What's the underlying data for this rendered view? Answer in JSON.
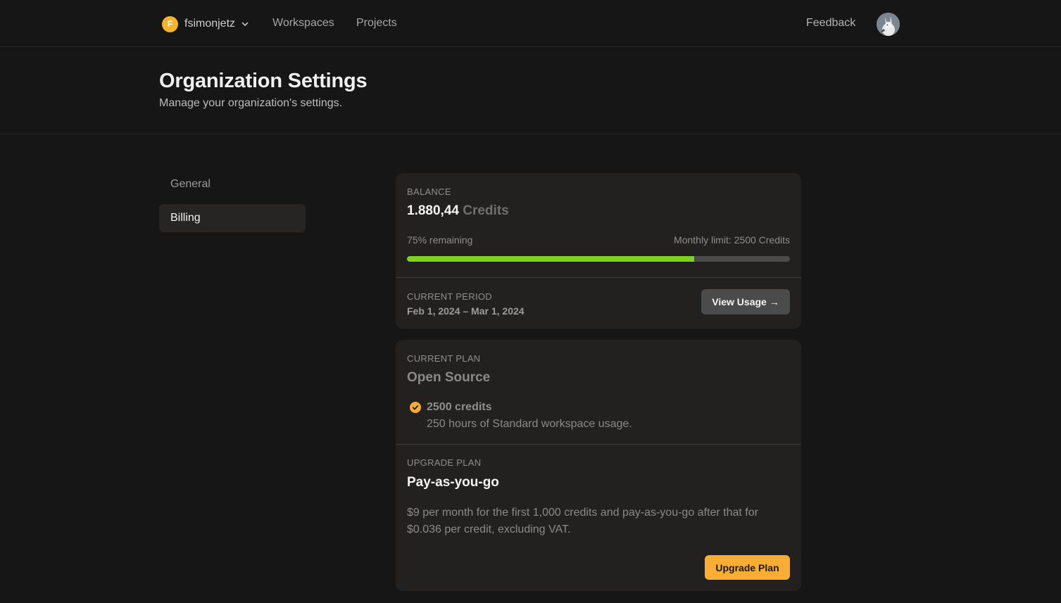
{
  "nav": {
    "org_initial": "F",
    "org_name": "fsimonjetz",
    "links": [
      "Workspaces",
      "Projects"
    ],
    "feedback": "Feedback"
  },
  "header": {
    "title": "Organization Settings",
    "subtitle": "Manage your organization's settings."
  },
  "sidebar": {
    "items": [
      {
        "label": "General",
        "active": false
      },
      {
        "label": "Billing",
        "active": true
      }
    ]
  },
  "balance": {
    "label": "BALANCE",
    "amount": "1.880,44",
    "unit": "Credits",
    "remaining_text": "75% remaining",
    "remaining_fraction": 0.75,
    "limit_text": "Monthly limit: 2500 Credits",
    "period_label": "CURRENT PERIOD",
    "period_value": "Feb 1, 2024 – Mar 1, 2024",
    "view_usage": "View Usage →"
  },
  "plan": {
    "label": "CURRENT PLAN",
    "name": "Open Source",
    "feature_title": "2500 credits",
    "feature_desc": "250 hours of Standard workspace usage.",
    "upgrade_label": "UPGRADE PLAN",
    "upgrade_name": "Pay-as-you-go",
    "upgrade_desc": "$9 per month for the first 1,000 credits and pay-as-you-go after that for $0.036 per credit, excluding VAT.",
    "upgrade_button": "Upgrade Plan"
  },
  "colors": {
    "accent": "#f9ae33",
    "progress": "#7ed321",
    "background": "#161616",
    "card": "#22211f"
  }
}
